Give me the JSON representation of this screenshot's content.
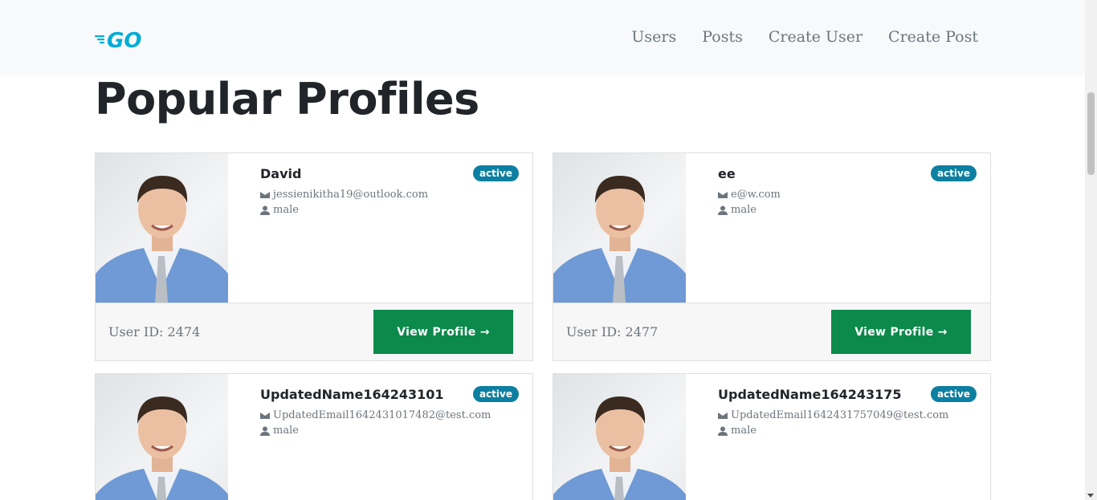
{
  "nav": {
    "logo_text": "GO",
    "links": [
      "Users",
      "Posts",
      "Create User",
      "Create Post"
    ]
  },
  "page": {
    "title": "Popular Profiles"
  },
  "profiles": [
    {
      "name": "David",
      "status": "active",
      "email": "jessienikitha19@outlook.com",
      "gender": "male",
      "user_id": "User ID: 2474",
      "button": "View Profile →"
    },
    {
      "name": "ee",
      "status": "active",
      "email": "e@w.com",
      "gender": "male",
      "user_id": "User ID: 2477",
      "button": "View Profile →"
    },
    {
      "name": "UpdatedName164243101",
      "status": "active",
      "email": "UpdatedEmail1642431017482@test.com",
      "gender": "male",
      "user_id": "",
      "button": ""
    },
    {
      "name": "UpdatedName164243175",
      "status": "active",
      "email": "UpdatedEmail1642431757049@test.com",
      "gender": "male",
      "user_id": "",
      "button": ""
    }
  ],
  "colors": {
    "accent_badge": "#0d7fa0",
    "button": "#0b8a4b",
    "logo": "#00acd7"
  },
  "icons": {
    "email": "envelope-icon",
    "gender": "user-icon"
  }
}
